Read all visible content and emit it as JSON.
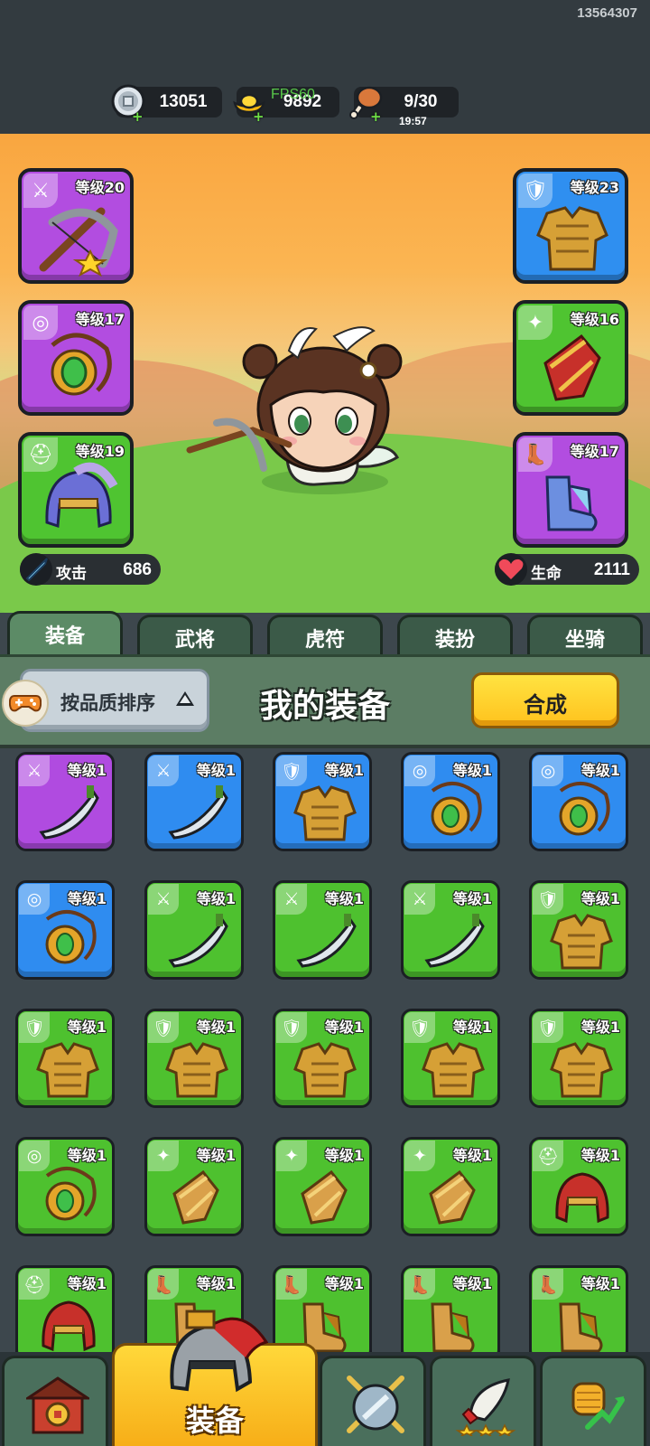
{
  "header": {
    "session_id": "13564307",
    "fps": "FPS60",
    "resources": [
      {
        "name": "silver-coin",
        "value": "13051"
      },
      {
        "name": "gold-ingot",
        "value": "9892"
      },
      {
        "name": "energy-drumstick",
        "value": "9/30",
        "timer": "19:57"
      }
    ]
  },
  "hero": {
    "equip_slots": [
      {
        "slot": "weapon",
        "level": "等级20",
        "rarity": "purple",
        "icon": "crossbow-icon"
      },
      {
        "slot": "armor",
        "level": "等级23",
        "rarity": "blue",
        "icon": "armor-icon"
      },
      {
        "slot": "amulet",
        "level": "等级17",
        "rarity": "purple",
        "icon": "amulet-icon"
      },
      {
        "slot": "bracer",
        "level": "等级16",
        "rarity": "green",
        "icon": "bracer-icon"
      },
      {
        "slot": "helmet",
        "level": "等级19",
        "rarity": "green",
        "icon": "helmet-icon"
      },
      {
        "slot": "boots",
        "level": "等级17",
        "rarity": "purple",
        "icon": "boots-icon"
      }
    ],
    "attack": {
      "label": "攻击",
      "value": "686"
    },
    "hp": {
      "label": "生命",
      "value": "2111"
    }
  },
  "tabs": [
    {
      "label": "装备",
      "active": true
    },
    {
      "label": "武将",
      "active": false
    },
    {
      "label": "虎符",
      "active": false
    },
    {
      "label": "装扮",
      "active": false
    },
    {
      "label": "坐骑",
      "active": false
    }
  ],
  "panel": {
    "sort_label": "按品质排序",
    "title": "我的装备",
    "merge_label": "合成"
  },
  "inventory": [
    {
      "level": "等级1",
      "rarity": "purple",
      "type": "weapon",
      "icon": "curved-blade-icon"
    },
    {
      "level": "等级1",
      "rarity": "blue",
      "type": "weapon",
      "icon": "crossbow-icon"
    },
    {
      "level": "等级1",
      "rarity": "blue",
      "type": "armor",
      "icon": "ornate-armor-icon"
    },
    {
      "level": "等级1",
      "rarity": "blue",
      "type": "amulet",
      "icon": "horn-amulet-icon"
    },
    {
      "level": "等级1",
      "rarity": "blue",
      "type": "amulet",
      "icon": "horn-amulet-icon"
    },
    {
      "level": "等级1",
      "rarity": "blue",
      "type": "amulet",
      "icon": "jeweled-amulet-icon"
    },
    {
      "level": "等级1",
      "rarity": "green",
      "type": "weapon",
      "icon": "shuriken-icon"
    },
    {
      "level": "等级1",
      "rarity": "green",
      "type": "weapon",
      "icon": "broadsword-icon"
    },
    {
      "level": "等级1",
      "rarity": "green",
      "type": "weapon",
      "icon": "broadsword-icon"
    },
    {
      "level": "等级1",
      "rarity": "green",
      "type": "armor",
      "icon": "robe-icon"
    },
    {
      "level": "等级1",
      "rarity": "green",
      "type": "armor",
      "icon": "red-armor-icon"
    },
    {
      "level": "等级1",
      "rarity": "green",
      "type": "armor",
      "icon": "red-armor-icon"
    },
    {
      "level": "等级1",
      "rarity": "green",
      "type": "armor",
      "icon": "gold-armor-icon"
    },
    {
      "level": "等级1",
      "rarity": "green",
      "type": "armor",
      "icon": "gold-armor-icon"
    },
    {
      "level": "等级1",
      "rarity": "green",
      "type": "armor",
      "icon": "ornate-armor-icon"
    },
    {
      "level": "等级1",
      "rarity": "green",
      "type": "amulet",
      "icon": "jade-amulet-icon"
    },
    {
      "level": "等级1",
      "rarity": "green",
      "type": "bracer",
      "icon": "bracer-icon"
    },
    {
      "level": "等级1",
      "rarity": "green",
      "type": "bracer",
      "icon": "bracer-icon"
    },
    {
      "level": "等级1",
      "rarity": "green",
      "type": "bracer",
      "icon": "bracer-icon"
    },
    {
      "level": "等级1",
      "rarity": "green",
      "type": "helmet",
      "icon": "helmet-icon"
    },
    {
      "level": "等级1",
      "rarity": "green",
      "type": "helmet",
      "icon": "helmet-icon"
    },
    {
      "level": "等级1",
      "rarity": "green",
      "type": "boots",
      "icon": "boots-icon"
    },
    {
      "level": "等级1",
      "rarity": "green",
      "type": "boots",
      "icon": "boots-icon"
    },
    {
      "level": "等级1",
      "rarity": "green",
      "type": "boots",
      "icon": "boots-icon"
    },
    {
      "level": "等级1",
      "rarity": "green",
      "type": "boots",
      "icon": "boots-icon"
    }
  ],
  "bottom_nav": [
    {
      "name": "city-gate",
      "icon": "gate-icon"
    },
    {
      "name": "equipment",
      "label": "装备",
      "icon": "helmet-icon",
      "active": true
    },
    {
      "name": "battle",
      "icon": "shield-swords-icon"
    },
    {
      "name": "summon",
      "icon": "horn-stars-icon"
    },
    {
      "name": "upgrade",
      "icon": "fist-arrow-icon"
    }
  ],
  "colors": {
    "purple": "#b04be0",
    "blue": "#2f8cf0",
    "green": "#4ec12f",
    "merge_button": "#ffc21d",
    "panel": "#5c7d64"
  }
}
